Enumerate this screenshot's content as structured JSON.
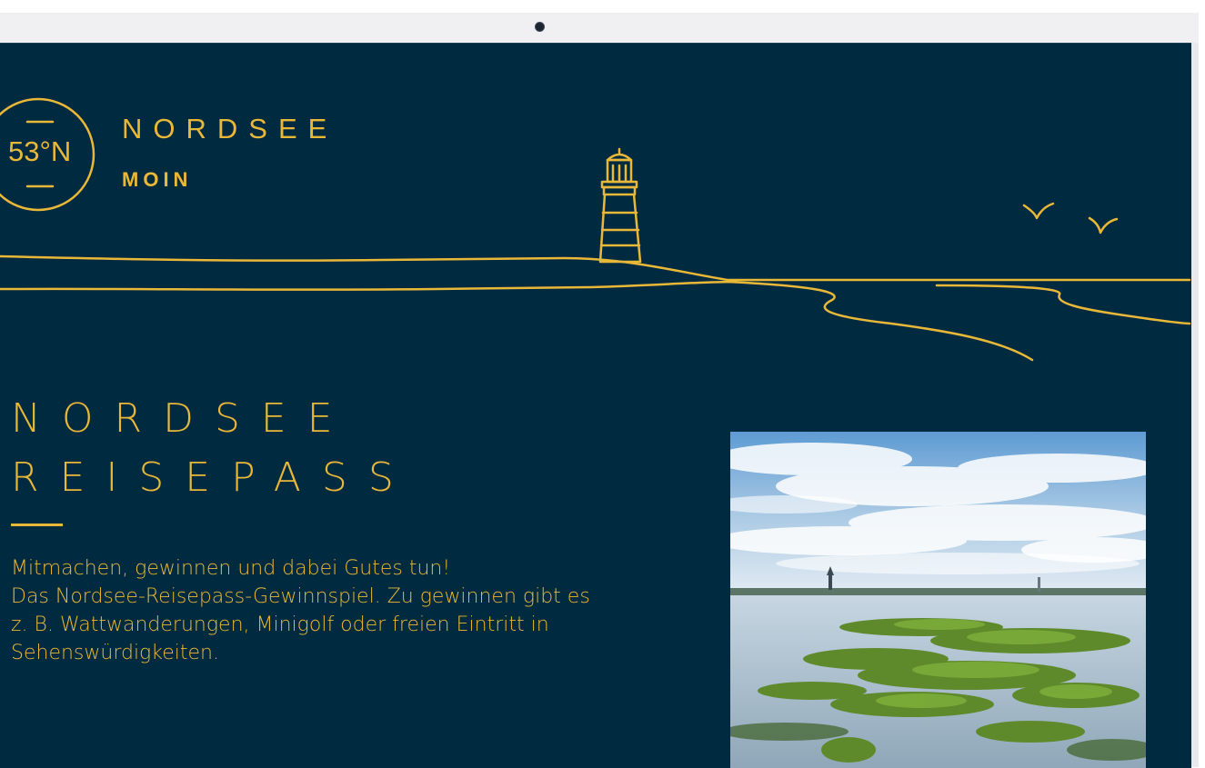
{
  "logo": {
    "degree_label": "53°N",
    "brand": "NORDSEE",
    "tagline": "MOIN"
  },
  "hero": {
    "headline_line1": "NORDSEE",
    "headline_line2": "REISEPASS",
    "intro_line1": "Mitmachen, gewinnen und dabei Gutes tun!",
    "intro_line2": "Das Nordsee-Reisepass-Gewinnspiel. Zu gewinnen gibt es",
    "intro_line3": "z. B. Wattwanderungen, Minigolf oder freien Eintritt in",
    "intro_line4": "Sehenswürdigkeiten."
  },
  "colors": {
    "background": "#002a40",
    "accent": "#e9b838"
  },
  "icons": {
    "lighthouse": "lighthouse-icon",
    "seagulls": "seagull-icon"
  }
}
